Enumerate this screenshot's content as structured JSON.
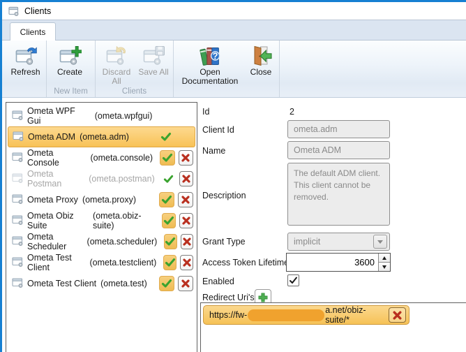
{
  "window": {
    "title": "Clients"
  },
  "tabs": [
    {
      "label": "Clients"
    }
  ],
  "ribbon": {
    "groups": [
      {
        "label": ""
      },
      {
        "label": "New Item"
      },
      {
        "label": "Clients"
      },
      {
        "label": ""
      }
    ],
    "buttons": [
      {
        "label": "Refresh",
        "icon": "refresh-window-icon",
        "enabled": true
      },
      {
        "label": "Create",
        "icon": "create-window-icon",
        "enabled": true
      },
      {
        "label": "Discard All",
        "icon": "discard-window-icon",
        "enabled": false
      },
      {
        "label": "Save All",
        "icon": "save-window-icon",
        "enabled": false
      },
      {
        "label": "Open Documentation",
        "icon": "documentation-books-icon",
        "enabled": true
      },
      {
        "label": "Close",
        "icon": "close-door-icon",
        "enabled": true
      }
    ]
  },
  "client_list": [
    {
      "name": "Ometa WPF Gui",
      "id": "(ometa.wpfgui)",
      "selected": false,
      "dimmed": false,
      "check": "none",
      "deletable": false
    },
    {
      "name": "Ometa ADM",
      "id": "(ometa.adm)",
      "selected": true,
      "dimmed": false,
      "check": "plain",
      "deletable": false
    },
    {
      "name": "Ometa Console",
      "id": "(ometa.console)",
      "selected": false,
      "dimmed": false,
      "check": "toggled",
      "deletable": true
    },
    {
      "name": "Ometa Postman",
      "id": "(ometa.postman)",
      "selected": false,
      "dimmed": true,
      "check": "plain",
      "deletable": true
    },
    {
      "name": "Ometa Proxy",
      "id": "(ometa.proxy)",
      "selected": false,
      "dimmed": false,
      "check": "toggled",
      "deletable": true
    },
    {
      "name": "Ometa Obiz Suite",
      "id": "(ometa.obiz-suite)",
      "selected": false,
      "dimmed": false,
      "check": "toggled",
      "deletable": true
    },
    {
      "name": "Ometa Scheduler",
      "id": "(ometa.scheduler)",
      "selected": false,
      "dimmed": false,
      "check": "toggled",
      "deletable": true
    },
    {
      "name": "Ometa Test Client",
      "id": "(ometa.testclient)",
      "selected": false,
      "dimmed": false,
      "check": "toggled",
      "deletable": true
    },
    {
      "name": "Ometa Test Client",
      "id": "(ometa.test)",
      "selected": false,
      "dimmed": false,
      "check": "toggled",
      "deletable": true
    }
  ],
  "form": {
    "id": {
      "label": "Id",
      "value": "2"
    },
    "client_id": {
      "label": "Client Id",
      "value": "ometa.adm"
    },
    "name": {
      "label": "Name",
      "value": "Ometa ADM"
    },
    "description": {
      "label": "Description",
      "value": "The default ADM client. This client cannot be removed."
    },
    "grant_type": {
      "label": "Grant Type",
      "value": "implicit"
    },
    "access_token_lifetime": {
      "label": "Access Token Lifetime",
      "value": "3600"
    },
    "enabled": {
      "label": "Enabled",
      "checked": true
    },
    "redirect_uris": {
      "label": "Redirect Uri's",
      "items": [
        {
          "prefix": "https://fw-",
          "redacted": true,
          "suffix": "a.net/obiz-suite/*"
        }
      ]
    }
  },
  "colors": {
    "accent_blue": "#1680d2",
    "selection_orange": "#f8c257",
    "selection_border": "#dfa640",
    "redaction_orange": "#f0a22e",
    "check_green": "#3aa32f",
    "delete_red": "#b92f1f"
  }
}
